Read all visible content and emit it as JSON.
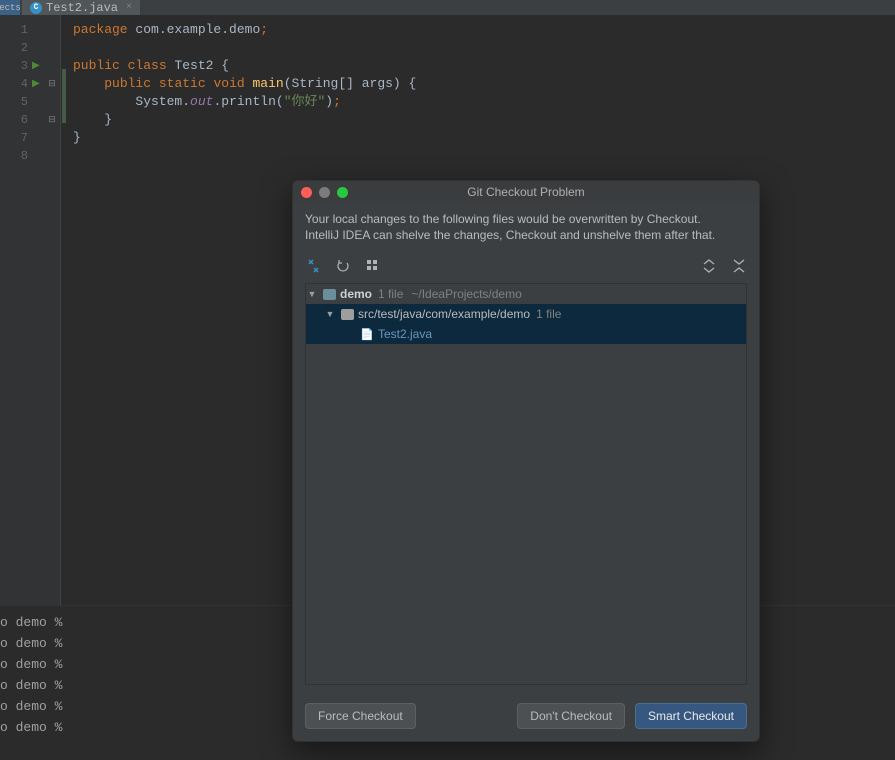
{
  "sidebar_stub": "ects",
  "tab": {
    "filename": "Test2.java",
    "close_glyph": "×"
  },
  "editor": {
    "lines": [
      1,
      2,
      3,
      4,
      5,
      6,
      7,
      8
    ],
    "code": {
      "package_kw": "package",
      "package_name": "com.example.demo",
      "public_kw": "public",
      "class_kw": "class",
      "class_name": "Test2",
      "static_kw": "static",
      "void_kw": "void",
      "main_fn": "main",
      "main_args": "(String[] args) {",
      "system": "System",
      "out": "out",
      "println": "println",
      "hello_str": "\"你好\"",
      "close_paren": ")",
      "open_brace": " {",
      "close_brace": "}"
    }
  },
  "terminal": {
    "prompt": "o demo %",
    "line_count": 6
  },
  "dialog": {
    "title": "Git Checkout Problem",
    "message_l1": "Your local changes to the following files would be overwritten by Checkout.",
    "message_l2": "IntelliJ IDEA can shelve the changes, Checkout and unshelve them after that.",
    "tree": {
      "root_name": "demo",
      "root_count": "1 file",
      "root_path": "~/IdeaProjects/demo",
      "dir_path": "src/test/java/com/example/demo",
      "dir_count": "1 file",
      "file_name": "Test2.java"
    },
    "buttons": {
      "force": "Force Checkout",
      "dont": "Don't Checkout",
      "smart": "Smart Checkout"
    }
  }
}
